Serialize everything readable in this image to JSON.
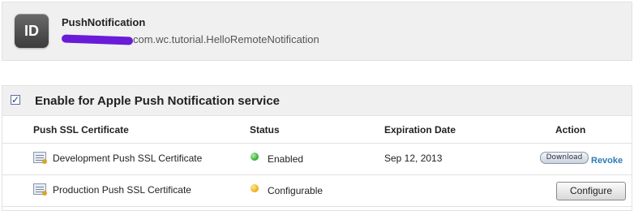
{
  "app_id": {
    "badge": "ID",
    "name": "PushNotification",
    "bundle_id": "com.wc.tutorial.HelloRemoteNotification"
  },
  "service": {
    "enable_label": "Enable for Apple Push Notification service",
    "enabled": true,
    "columns": {
      "certificate": "Push SSL Certificate",
      "status": "Status",
      "expiration": "Expiration Date",
      "action": "Action"
    },
    "rows": [
      {
        "name": "Development Push SSL Certificate",
        "status": "Enabled",
        "status_color": "#3fb33a",
        "expiration": "Sep 12, 2013",
        "download_label": "Download",
        "revoke_label": "Revoke"
      },
      {
        "name": "Production Push SSL Certificate",
        "status": "Configurable",
        "status_color": "#f2b31d",
        "expiration": "",
        "configure_label": "Configure"
      }
    ]
  }
}
